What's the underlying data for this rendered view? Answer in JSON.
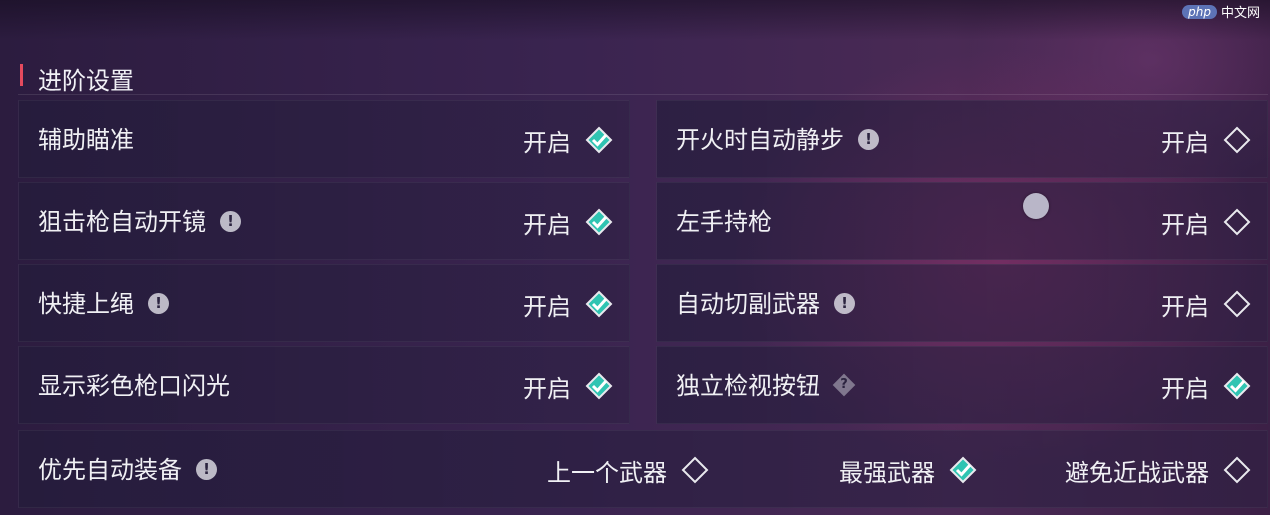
{
  "watermark": {
    "badge": "php",
    "text": "中文网"
  },
  "section": {
    "title": "进阶设置"
  },
  "colors": {
    "accent_teal": "#2fc4b2",
    "title_bar_red": "#e54a5e"
  },
  "settings": [
    {
      "label": "辅助瞄准",
      "option": "开启",
      "checked": true,
      "hint": "none"
    },
    {
      "label": "开火时自动静步",
      "option": "开启",
      "checked": false,
      "hint": "info-icon",
      "hint_text": "!"
    },
    {
      "label": "狙击枪自动开镜",
      "option": "开启",
      "checked": true,
      "hint": "info-icon",
      "hint_text": "!"
    },
    {
      "label": "左手持枪",
      "option": "开启",
      "checked": false,
      "hint": "none"
    },
    {
      "label": "快捷上绳",
      "option": "开启",
      "checked": true,
      "hint": "info-icon",
      "hint_text": "!"
    },
    {
      "label": "自动切副武器",
      "option": "开启",
      "checked": false,
      "hint": "info-icon",
      "hint_text": "!"
    },
    {
      "label": "显示彩色枪口闪光",
      "option": "开启",
      "checked": true,
      "hint": "none"
    },
    {
      "label": "独立检视按钮",
      "option": "开启",
      "checked": true,
      "hint": "question-icon",
      "hint_text": "?"
    }
  ],
  "auto_equip": {
    "label": "优先自动装备",
    "hint_text": "!",
    "options": [
      {
        "label": "上一个武器",
        "checked": false
      },
      {
        "label": "最强武器",
        "checked": true
      },
      {
        "label": "避免近战武器",
        "checked": false
      }
    ]
  }
}
